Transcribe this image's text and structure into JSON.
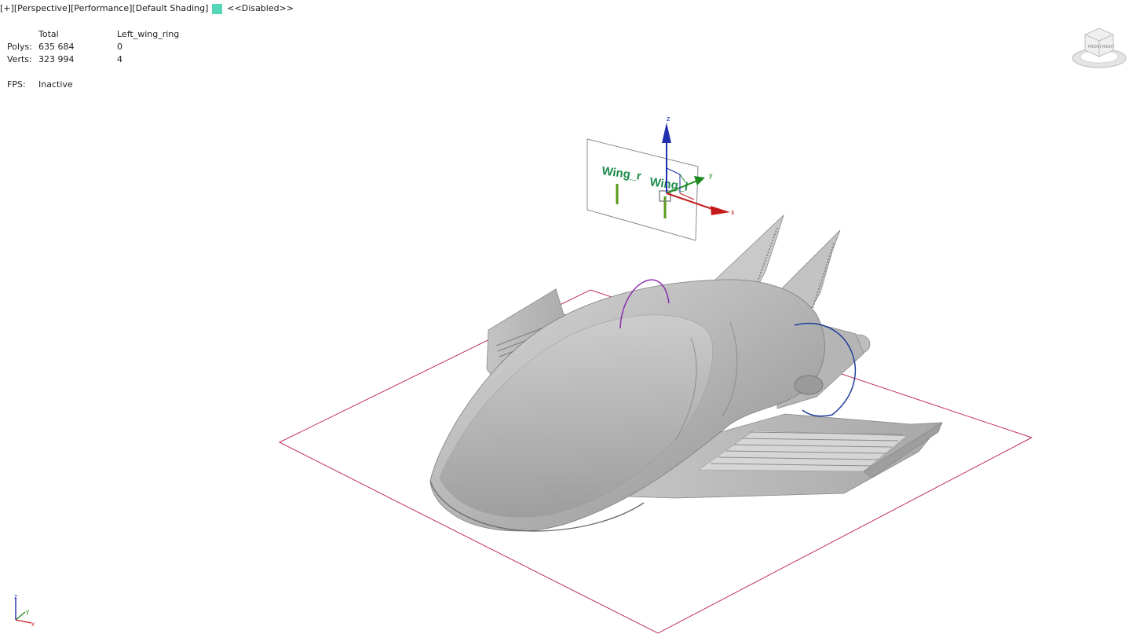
{
  "viewport": {
    "labels": [
      "[+]",
      "[Perspective]",
      "[Performance]",
      "[Default Shading]"
    ],
    "swatch_color": "#56d6b8",
    "status": "<<Disabled>>"
  },
  "stats": {
    "header_total": "Total",
    "header_selection": "Left_wing_ring",
    "polys_label": "Polys:",
    "polys_total": "635 684",
    "polys_selection": "0",
    "verts_label": "Verts:",
    "verts_total": "323 994",
    "verts_selection": "4",
    "fps_label": "FPS:",
    "fps_value": "Inactive"
  },
  "scene": {
    "control_labels": [
      "Wing_r",
      "Wing_l"
    ],
    "gizmo_axes": [
      "z",
      "y",
      "x"
    ],
    "label_color": "#1e8a4a",
    "grid_color": "#c0305a"
  },
  "viewcube": {
    "faces": [
      "FRONT",
      "RIGHT"
    ]
  },
  "axis_tripod": {
    "z": "z",
    "y": "y",
    "x": "x"
  },
  "icons": {
    "viewcube": "viewcube-icon",
    "tripod": "axis-tripod-icon",
    "gizmo": "move-gizmo-icon"
  }
}
